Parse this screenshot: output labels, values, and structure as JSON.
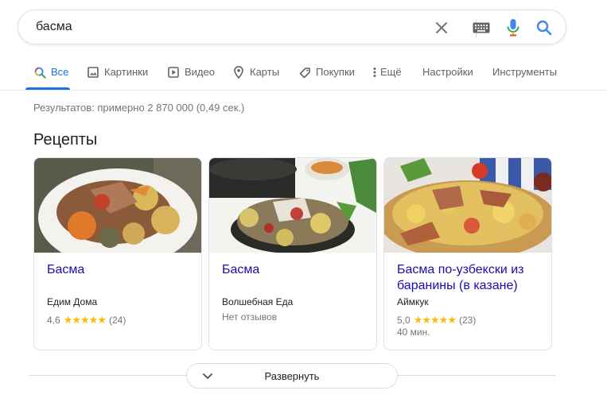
{
  "search": {
    "query": "басма"
  },
  "tabs": [
    {
      "label": "Все",
      "icon": "search-icon",
      "active": true
    },
    {
      "label": "Картинки",
      "icon": "image-icon"
    },
    {
      "label": "Видео",
      "icon": "play-icon"
    },
    {
      "label": "Карты",
      "icon": "map-pin-icon"
    },
    {
      "label": "Покупки",
      "icon": "tag-icon"
    },
    {
      "label": "Ещё",
      "icon": "more-vert-icon"
    },
    {
      "label": "Настройки"
    },
    {
      "label": "Инструменты"
    }
  ],
  "result_stats": "Результатов: примерно 2 870 000 (0,49 сек.)",
  "recipes": {
    "title": "Рецепты",
    "cards": [
      {
        "title": "Басма",
        "source": "Едим Дома",
        "rating": "4,6",
        "stars": "★★★★★",
        "reviews": "(24)"
      },
      {
        "title": "Басма",
        "source": "Волшебная Еда",
        "no_reviews": "Нет отзывов"
      },
      {
        "title": "Басма по-узбекски из баранины (в казане)",
        "source": "Аймкук",
        "rating": "5,0",
        "stars": "★★★★★",
        "reviews": "(23)",
        "time": "40 мин."
      }
    ],
    "expand_label": "Развернуть"
  },
  "colors": {
    "link": "#1a0dab",
    "accent": "#1a73e8",
    "star": "#fbbc04"
  }
}
